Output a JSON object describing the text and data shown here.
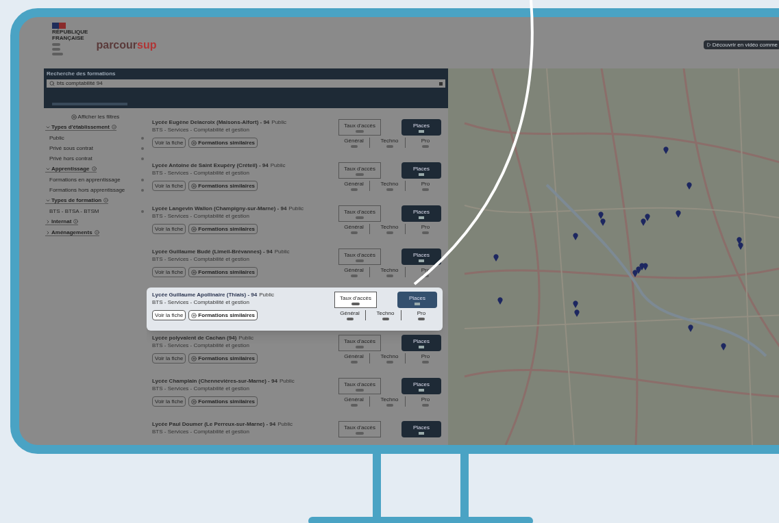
{
  "header": {
    "gov_logo_lines": [
      "RÉPUBLIQUE",
      "FRANÇAISE"
    ],
    "brand": {
      "part1": "parcour",
      "part2": "sup"
    },
    "video_button": "Découvrir en vidéo comme"
  },
  "search": {
    "title": "Recherche des formations",
    "value": "bts comptabilité 94"
  },
  "filters": {
    "toggle": "Afficher les filtres",
    "groups": [
      {
        "label": "Types d'établissement",
        "expanded": true,
        "options": [
          "Public",
          "Privé sous contrat",
          "Privé hors contrat"
        ]
      },
      {
        "label": "Apprentissage",
        "expanded": true,
        "options": [
          "Formations en apprentissage",
          "Formations hors apprentissage"
        ]
      },
      {
        "label": "Types de formation",
        "expanded": true,
        "options": [
          "BTS - BTSA - BTSM"
        ]
      },
      {
        "label": "Internat",
        "expanded": false
      },
      {
        "label": "Aménagements",
        "expanded": false
      }
    ]
  },
  "results": [
    {
      "name": "Lycée Eugène Delacroix (Maisons-Alfort) - 94",
      "status": "Public",
      "program": "BTS - Services - Comptabilité et gestion",
      "highlighted": false,
      "details": "Voir la fiche",
      "similar": "Formations similaires",
      "access": "Taux d'accès",
      "places": "Places",
      "general": "Général",
      "techno": "Techno",
      "pro": "Pro"
    },
    {
      "name": "Lycée Antoine de Saint Exupéry (Créteil) - 94",
      "status": "Public",
      "program": "BTS - Services - Comptabilité et gestion",
      "highlighted": false,
      "details": "Voir la fiche",
      "similar": "Formations similaires",
      "access": "Taux d'accès",
      "places": "Places",
      "general": "Général",
      "techno": "Techno",
      "pro": "Pro"
    },
    {
      "name": "Lycée Langevin Wallon (Champigny-sur-Marne) - 94",
      "status": "Public",
      "program": "BTS - Services - Comptabilité et gestion",
      "highlighted": false,
      "details": "Voir la fiche",
      "similar": "Formations similaires",
      "access": "Taux d'accès",
      "places": "Places",
      "general": "Général",
      "techno": "Techno",
      "pro": "Pro"
    },
    {
      "name": "Lycée Guillaume Budé (Limeil-Brévannes) - 94",
      "status": "Public",
      "program": "BTS - Services - Comptabilité et gestion",
      "highlighted": false,
      "details": "Voir la fiche",
      "similar": "Formations similaires",
      "access": "Taux d'accès",
      "places": "Places",
      "general": "Général",
      "techno": "Techno",
      "pro": "Pro"
    },
    {
      "name": "Lycée Guillaume Apollinaire (Thiais) - 94",
      "status": "Public",
      "program": "BTS - Services - Comptabilité et gestion",
      "highlighted": true,
      "details": "Voir la fiche",
      "similar": "Formations similaires",
      "access": "Taux d'accès",
      "places": "Places",
      "general": "Général",
      "techno": "Techno",
      "pro": "Pro"
    },
    {
      "name": "Lycée polyvalent de Cachan (94)",
      "status": "Public",
      "program": "BTS - Services - Comptabilité et gestion",
      "highlighted": false,
      "details": "Voir la fiche",
      "similar": "Formations similaires",
      "access": "Taux d'accès",
      "places": "Places",
      "general": "Général",
      "techno": "Techno",
      "pro": "Pro"
    },
    {
      "name": "Lycée Champlain (Chennevières-sur-Marne) - 94",
      "status": "Public",
      "program": "BTS - Services - Comptabilité et gestion",
      "highlighted": false,
      "details": "Voir la fiche",
      "similar": "Formations similaires",
      "access": "Taux d'accès",
      "places": "Places",
      "general": "Général",
      "techno": "Techno",
      "pro": "Pro"
    },
    {
      "name": "Lycée Paul Doumer (Le Perreux-sur-Marne) - 94",
      "status": "Public",
      "program": "BTS - Services - Comptabilité et gestion",
      "highlighted": false,
      "access": "Taux d'accès",
      "places": "Places"
    }
  ]
}
